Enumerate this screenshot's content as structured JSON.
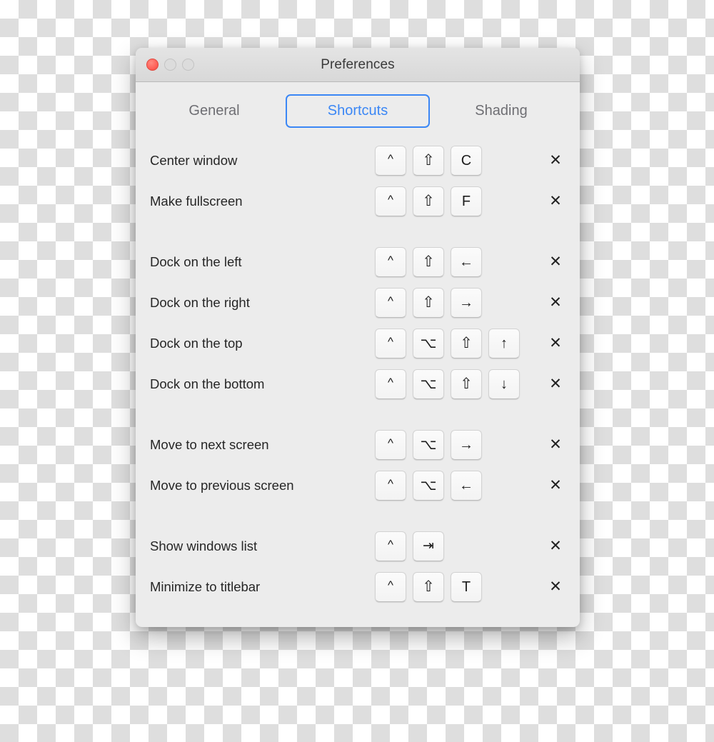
{
  "window": {
    "title": "Preferences",
    "traffic_lights": [
      {
        "name": "close",
        "color": "#FF5F57",
        "state": "active"
      },
      {
        "name": "minimize",
        "color": "#DCDCDC",
        "state": "disabled"
      },
      {
        "name": "zoom",
        "color": "#DCDCDC",
        "state": "disabled"
      }
    ]
  },
  "tabs": [
    {
      "label": "General",
      "active": false
    },
    {
      "label": "Shortcuts",
      "active": true
    },
    {
      "label": "Shading",
      "active": false
    }
  ],
  "colors": {
    "accent": "#3b87f5",
    "window_body": "#ECECEC",
    "titlebar": "#DCDCDC",
    "label_text": "#262626",
    "inactive_tab_text": "#6E6E73"
  },
  "delete_icon": "✕",
  "groups": [
    {
      "rows": [
        {
          "label": "Center window",
          "keys": [
            "^",
            "⇧",
            "C"
          ],
          "key_names": [
            "control",
            "shift",
            "c"
          ],
          "delete": "✕"
        },
        {
          "label": "Make fullscreen",
          "keys": [
            "^",
            "⇧",
            "F"
          ],
          "key_names": [
            "control",
            "shift",
            "f"
          ],
          "delete": "✕"
        }
      ]
    },
    {
      "rows": [
        {
          "label": "Dock on the left",
          "keys": [
            "^",
            "⇧",
            "←"
          ],
          "key_names": [
            "control",
            "shift",
            "left-arrow"
          ],
          "delete": "✕"
        },
        {
          "label": "Dock on the right",
          "keys": [
            "^",
            "⇧",
            "→"
          ],
          "key_names": [
            "control",
            "shift",
            "right-arrow"
          ],
          "delete": "✕"
        },
        {
          "label": "Dock on the top",
          "keys": [
            "^",
            "⌥",
            "⇧",
            "↑"
          ],
          "key_names": [
            "control",
            "option",
            "shift",
            "up-arrow"
          ],
          "delete": "✕"
        },
        {
          "label": "Dock on the bottom",
          "keys": [
            "^",
            "⌥",
            "⇧",
            "↓"
          ],
          "key_names": [
            "control",
            "option",
            "shift",
            "down-arrow"
          ],
          "delete": "✕"
        }
      ]
    },
    {
      "rows": [
        {
          "label": "Move to next screen",
          "keys": [
            "^",
            "⌥",
            "→"
          ],
          "key_names": [
            "control",
            "option",
            "right-arrow"
          ],
          "delete": "✕"
        },
        {
          "label": "Move to previous screen",
          "keys": [
            "^",
            "⌥",
            "←"
          ],
          "key_names": [
            "control",
            "option",
            "left-arrow"
          ],
          "delete": "✕"
        }
      ]
    },
    {
      "rows": [
        {
          "label": "Show windows list",
          "keys": [
            "^",
            "⇥"
          ],
          "key_names": [
            "control",
            "tab"
          ],
          "delete": "✕"
        },
        {
          "label": "Minimize to titlebar",
          "keys": [
            "^",
            "⇧",
            "T"
          ],
          "key_names": [
            "control",
            "shift",
            "t"
          ],
          "delete": "✕"
        }
      ]
    }
  ]
}
